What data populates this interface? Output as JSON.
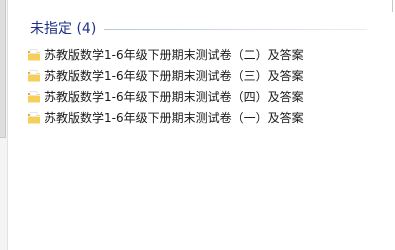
{
  "group": {
    "title": "未指定 (4)"
  },
  "items": [
    {
      "label": "苏教版数学1-6年级下册期末测试卷（二）及答案",
      "icon": "folder-icon"
    },
    {
      "label": "苏教版数学1-6年级下册期末测试卷（三）及答案",
      "icon": "folder-icon"
    },
    {
      "label": "苏教版数学1-6年级下册期末测试卷（四）及答案",
      "icon": "folder-icon"
    },
    {
      "label": "苏教版数学1-6年级下册期末测试卷（一）及答案",
      "icon": "folder-icon"
    }
  ],
  "colors": {
    "group_title": "#1e3287",
    "folder_body": "#f2c94c",
    "folder_tab": "#e0a82e"
  }
}
